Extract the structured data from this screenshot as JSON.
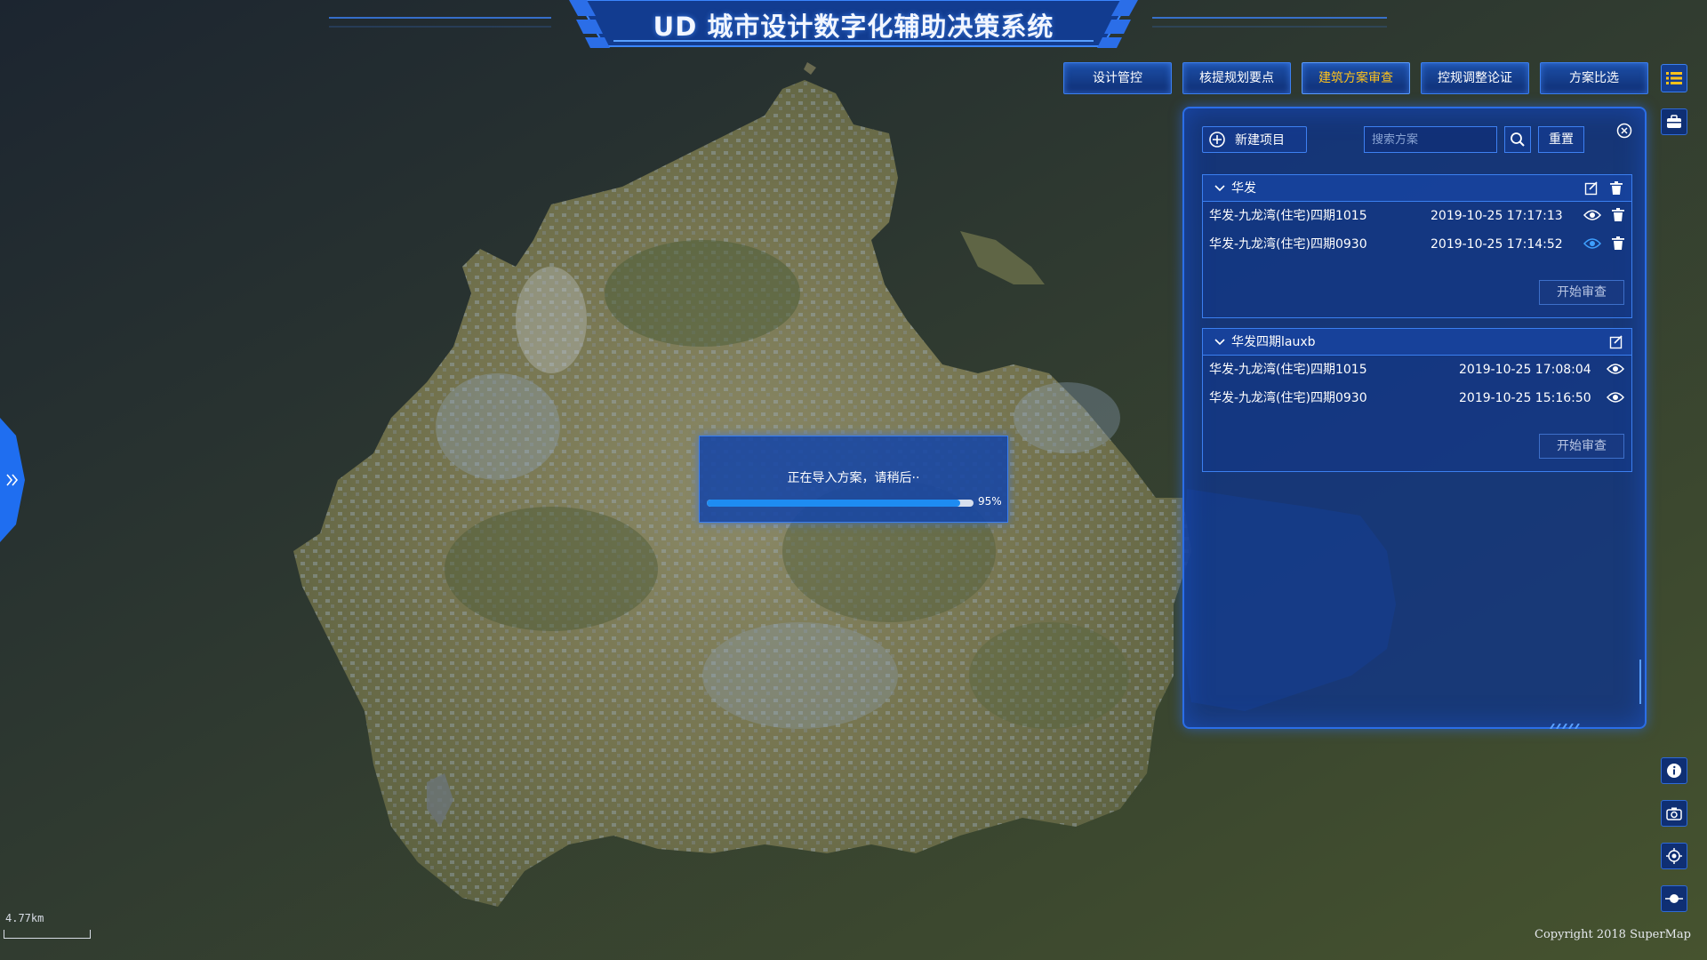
{
  "app": {
    "title": "UD 城市设计数字化辅助决策系统"
  },
  "nav": {
    "tabs": [
      {
        "label": "设计管控",
        "active": false
      },
      {
        "label": "核提规划要点",
        "active": false
      },
      {
        "label": "建筑方案审查",
        "active": true
      },
      {
        "label": "控规调整论证",
        "active": false
      },
      {
        "label": "方案比选",
        "active": false
      }
    ]
  },
  "panel": {
    "new_project_label": "新建项目",
    "search_placeholder": "搜索方案",
    "reset_label": "重置",
    "groups": [
      {
        "name": "华发",
        "items": [
          {
            "name": "华发-九龙湾(住宅)四期1015",
            "time": "2019-10-25 17:17:13"
          },
          {
            "name": "华发-九龙湾(住宅)四期0930",
            "time": "2019-10-25 17:14:52"
          }
        ],
        "start_label": "开始审查"
      },
      {
        "name": "华发四期lauxb",
        "items": [
          {
            "name": "华发-九龙湾(住宅)四期1015",
            "time": "2019-10-25 17:08:04"
          },
          {
            "name": "华发-九龙湾(住宅)四期0930",
            "time": "2019-10-25 15:16:50"
          }
        ],
        "start_label": "开始审查"
      }
    ]
  },
  "loading": {
    "message": "正在导入方案，请稍后··",
    "progress": 0.95,
    "progress_label": "95%"
  },
  "map": {
    "scale_label": "4.77km",
    "copyright": "Copyright 2018 SuperMap"
  },
  "colors": {
    "accent": "#2b6ee8",
    "active_tab": "#ffc21a",
    "progress": "#1e8cf2"
  }
}
